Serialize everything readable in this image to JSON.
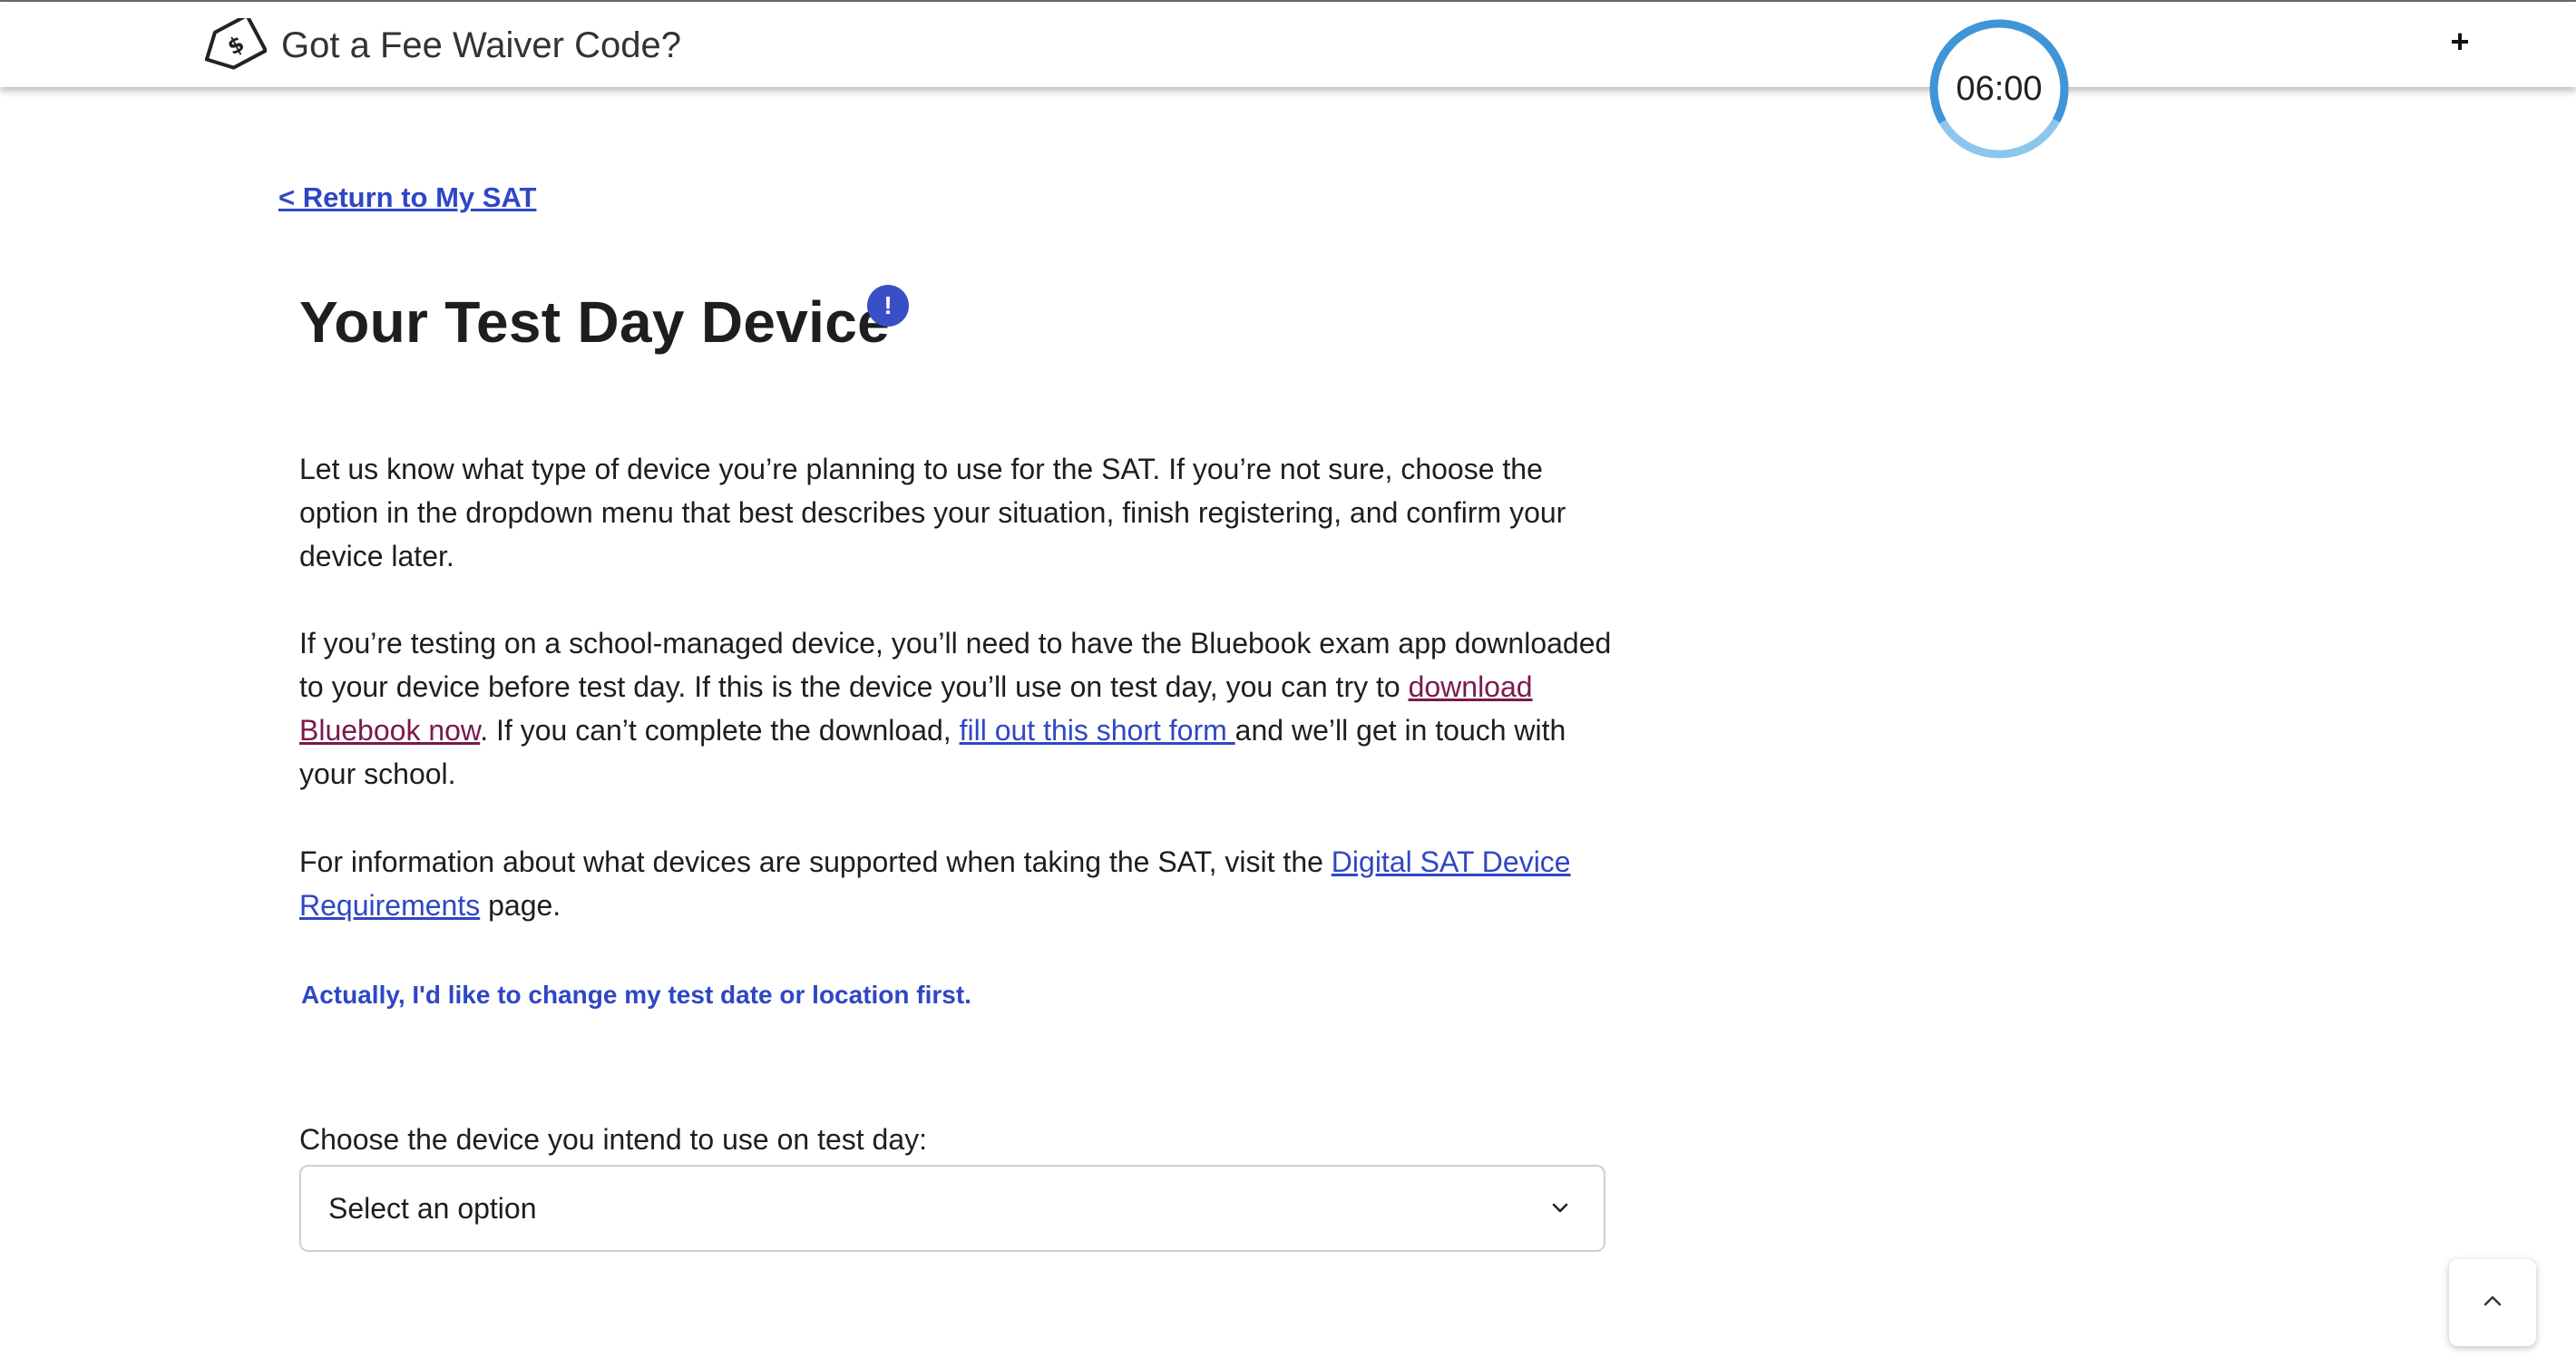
{
  "header": {
    "fee_waiver_label": "Got a Fee Waiver Code?",
    "fee_waiver_icon": "price-tag-icon",
    "plus_label": "+",
    "timer": {
      "time": "06:00",
      "ring_color": "#4a9fdd"
    }
  },
  "main": {
    "return_link": "< Return to My SAT",
    "title": "Your Test Day Device",
    "info_badge": "!",
    "paragraph1": "Let us know what type of device you’re planning to use for the SAT. If you’re not sure, choose the option in the dropdown menu that best describes your situation, finish registering, and confirm your device later.",
    "paragraph2": {
      "part1": "If you’re testing on a school-managed device, you’ll need to have the Bluebook exam app downloaded to your device before test day. If this is the device you’ll use on test day, you can try to ",
      "link1": "download Bluebook now",
      "part2": ". If you can’t complete the download, ",
      "link2": "fill out this short form ",
      "part3": "and we’ll get in touch with your school."
    },
    "paragraph3": {
      "part1": "For information about what devices are supported when taking the SAT, visit the ",
      "link": "Digital SAT Device Requirements",
      "part2": " page."
    },
    "change_link": "Actually, I'd like to change my test date or location first.",
    "device_select": {
      "label": "Choose the device you intend to use on test day:",
      "value": "Select an option"
    }
  },
  "colors": {
    "link": "#2f47c4",
    "visited_link": "#7a1a4a",
    "badge": "#3a4fc6"
  }
}
